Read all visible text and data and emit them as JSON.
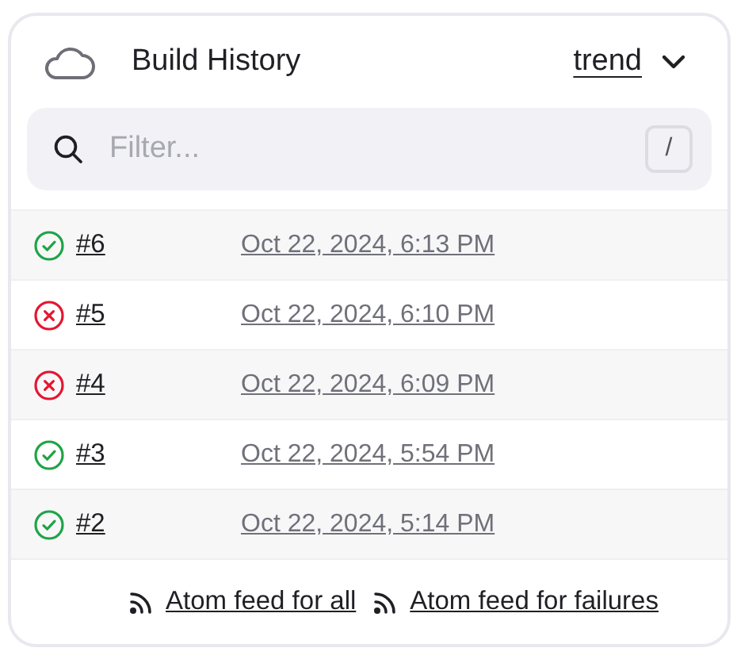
{
  "header": {
    "title": "Build History",
    "trend_link": "trend"
  },
  "search": {
    "placeholder": "Filter...",
    "shortcut": "/"
  },
  "builds": [
    {
      "passed": true,
      "number": "#6",
      "time": "Oct 22, 2024, 6:13 PM"
    },
    {
      "passed": false,
      "number": "#5",
      "time": "Oct 22, 2024, 6:10 PM"
    },
    {
      "passed": false,
      "number": "#4",
      "time": "Oct 22, 2024, 6:09 PM"
    },
    {
      "passed": true,
      "number": "#3",
      "time": "Oct 22, 2024, 5:54 PM"
    },
    {
      "passed": true,
      "number": "#2",
      "time": "Oct 22, 2024, 5:14 PM"
    }
  ],
  "feeds": [
    "Atom feed for all",
    "Atom feed for failures"
  ]
}
